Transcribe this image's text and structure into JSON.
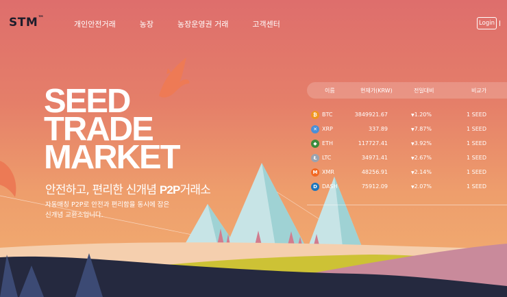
{
  "header": {
    "logo": "STM",
    "logo_mark": "™",
    "nav": [
      "개인안전거래",
      "농장",
      "농장운영권 거래",
      "고객센터"
    ],
    "login_label": "Login"
  },
  "hero": {
    "title_lines": [
      "SEED",
      "TRADE",
      "MARKET"
    ],
    "subtitle_pre": "안전하고, 편리한 신개념 ",
    "subtitle_bold": "P2P",
    "subtitle_post": "거래소",
    "description": [
      "자동매칭 P2P로 안전과 편리함을 동시에 잡은",
      "신개념 교환소입니다."
    ]
  },
  "ticker": {
    "headers": [
      "이름",
      "현재가(KRW)",
      "전일대비",
      "비교가"
    ],
    "rows": [
      {
        "name": "BTC",
        "price": "3849921.67",
        "change": "-1.20%",
        "compare": "1 SEED",
        "icon": "bitcoin-icon",
        "color": "#f0951f",
        "glyph": "₿"
      },
      {
        "name": "XRP",
        "price": "337.89",
        "change": "-7.87%",
        "compare": "1 SEED",
        "icon": "ripple-icon",
        "color": "#4a8fd8",
        "glyph": "✕"
      },
      {
        "name": "ETH",
        "price": "117727.41",
        "change": "-3.92%",
        "compare": "1 SEED",
        "icon": "ethereum-icon",
        "color": "#3b8b3b",
        "glyph": "◆"
      },
      {
        "name": "LTC",
        "price": "34971.41",
        "change": "-2.67%",
        "compare": "1 SEED",
        "icon": "litecoin-icon",
        "color": "#9aa3b0",
        "glyph": "Ł"
      },
      {
        "name": "XMR",
        "price": "48256.91",
        "change": "-2.14%",
        "compare": "1 SEED",
        "icon": "monero-icon",
        "color": "#f26822",
        "glyph": "M"
      },
      {
        "name": "DASH",
        "price": "75912.09",
        "change": "-2.07%",
        "compare": "1 SEED",
        "icon": "dash-icon",
        "color": "#1c75bc",
        "glyph": "D"
      }
    ]
  },
  "colors": {
    "logo": "#1d1d2b",
    "ground": "#25293f",
    "hill_pink": "#c98a9b",
    "grass": "#cdc235",
    "sand": "#f5cfae"
  }
}
